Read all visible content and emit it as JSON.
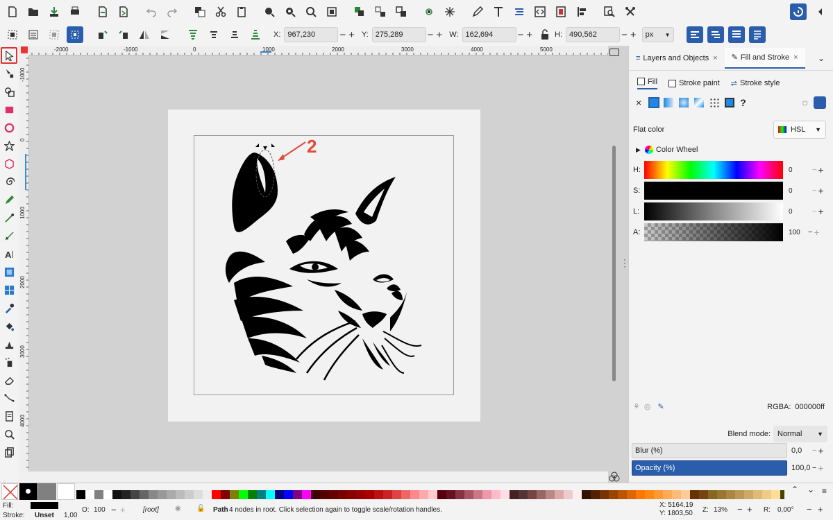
{
  "toolbar": {
    "unit": "px"
  },
  "selection": {
    "x_label": "X:",
    "x_value": "967,230",
    "y_label": "Y:",
    "y_value": "275,289",
    "w_label": "W:",
    "w_value": "162,694",
    "h_label": "H:",
    "h_value": "490,562"
  },
  "rulers": {
    "top_ticks": [
      "-2000",
      "-1000",
      "0",
      "1000",
      "2000",
      "3000",
      "4000",
      "5000"
    ],
    "left_ticks": [
      "-1000",
      "0",
      "1000",
      "2000",
      "3000",
      "4000"
    ]
  },
  "annotation": {
    "label": "2"
  },
  "dock": {
    "tabs": [
      {
        "label": "Layers and Objects"
      },
      {
        "label": "Fill and Stroke"
      }
    ],
    "subtabs": {
      "fill": "Fill",
      "stroke_paint": "Stroke paint",
      "stroke_style": "Stroke style"
    },
    "flat_color_label": "Flat color",
    "color_mode": "HSL",
    "color_wheel_label": "Color Wheel",
    "sliders": [
      {
        "label": "H:",
        "value": "0"
      },
      {
        "label": "S:",
        "value": "0"
      },
      {
        "label": "L:",
        "value": "0"
      },
      {
        "label": "A:",
        "value": "100"
      }
    ],
    "rgba_label": "RGBA:",
    "rgba_value": "000000ff",
    "blend_label": "Blend mode:",
    "blend_value": "Normal",
    "blur_label": "Blur (%)",
    "blur_value": "0,0",
    "opacity_label": "Opacity (%)",
    "opacity_value": "100,0",
    "colors": {
      "accent": "#2a5dab",
      "active_tab_border": "#2a5dab"
    }
  },
  "status": {
    "fill_label": "Fill:",
    "stroke_label": "Stroke:",
    "stroke_value": "Unset",
    "stroke_width": "1,00",
    "opacity_label": "O:",
    "opacity_value": "100",
    "layer": "[root]",
    "message_bold": "Path",
    "message": " 4 nodes in root. Click selection again to toggle scale/rotation handles.",
    "x_coord": "X: 5164,19",
    "y_coord": "Y: 1803,50",
    "zoom_label": "Z:",
    "zoom_value": "13%",
    "rotation_label": "R:",
    "rotation_value": "0,00°"
  },
  "palette": {
    "swatches": [
      "#000000",
      "#ffffff",
      "#808080",
      "#ffffff",
      "#111111",
      "#222222",
      "#444444",
      "#666666",
      "#888888",
      "#999999",
      "#aaaaaa",
      "#bbbbbb",
      "#cccccc",
      "#dddddd",
      "#eeeeee",
      "#ff0000",
      "#800000",
      "#808000",
      "#00ff00",
      "#008000",
      "#008080",
      "#00ffff",
      "#000080",
      "#0000ff",
      "#800080",
      "#ff00ff",
      "#400000",
      "#550000",
      "#660000",
      "#770000",
      "#880000",
      "#990000",
      "#aa0000",
      "#bb1111",
      "#cc2222",
      "#dd4444",
      "#ee6666",
      "#ff8888",
      "#ffaaaa",
      "#ffcccc",
      "#550011",
      "#661122",
      "#883344",
      "#aa5566",
      "#cc7788",
      "#ee99aa",
      "#ffbbcc",
      "#ffdde5",
      "#442222",
      "#553333",
      "#774444",
      "#996666",
      "#bb8888",
      "#ddaaaa",
      "#eecccc",
      "#ffeeee",
      "#331100",
      "#552200",
      "#773300",
      "#994400",
      "#bb5500",
      "#dd6600",
      "#ff7700",
      "#ff8811",
      "#ff9933",
      "#ffaa55",
      "#ffbb77",
      "#ffcc99",
      "#663300",
      "#774411",
      "#886622",
      "#997733",
      "#aa8844",
      "#bb9955",
      "#ccaa66",
      "#ddbb77",
      "#eecc88",
      "#ffdd99",
      "#444400",
      "#555511",
      "#777722",
      "#999933",
      "#bbbb44"
    ]
  }
}
